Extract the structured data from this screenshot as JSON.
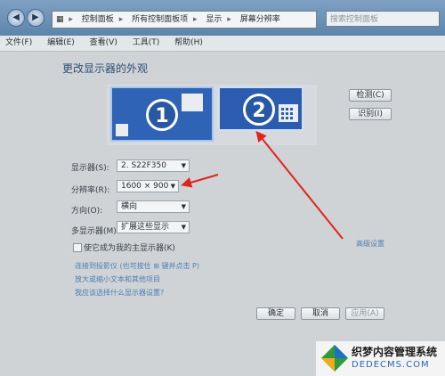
{
  "address": {
    "parts": [
      "控制面板",
      "所有控制面板项",
      "显示",
      "屏幕分辨率"
    ],
    "search_placeholder": "搜索控制面板"
  },
  "menu": [
    "文件(F)",
    "编辑(E)",
    "查看(V)",
    "工具(T)",
    "帮助(H)"
  ],
  "heading": "更改显示器的外观",
  "monitors": [
    {
      "number": "1"
    },
    {
      "number": "2"
    }
  ],
  "buttons": {
    "detect": "检测(C)",
    "identify": "识别(I)"
  },
  "fields": {
    "display": {
      "label": "显示器(S):",
      "value": "2. S22F350"
    },
    "resolution": {
      "label": "分辨率(R):",
      "value": "1600 × 900"
    },
    "orientation": {
      "label": "方向(O):",
      "value": "横向"
    },
    "multi": {
      "label": "多显示器(M):",
      "value": "扩展这些显示"
    }
  },
  "checkbox_label": "使它成为我的主显示器(K)",
  "advanced_link": "高级设置",
  "links": [
    "连接到投影仪 (也可按住 ⊞ 键并点击 P)",
    "放大或缩小文本和其他项目",
    "我应该选择什么显示器设置?"
  ],
  "footer_buttons": {
    "ok": "确定",
    "cancel": "取消",
    "apply": "应用(A)"
  },
  "watermark": {
    "title": "织梦内容管理系统",
    "url": "DEDECMS.COM"
  },
  "colors": {
    "accent": "#2f63b5",
    "arrow": "#e0241b"
  }
}
